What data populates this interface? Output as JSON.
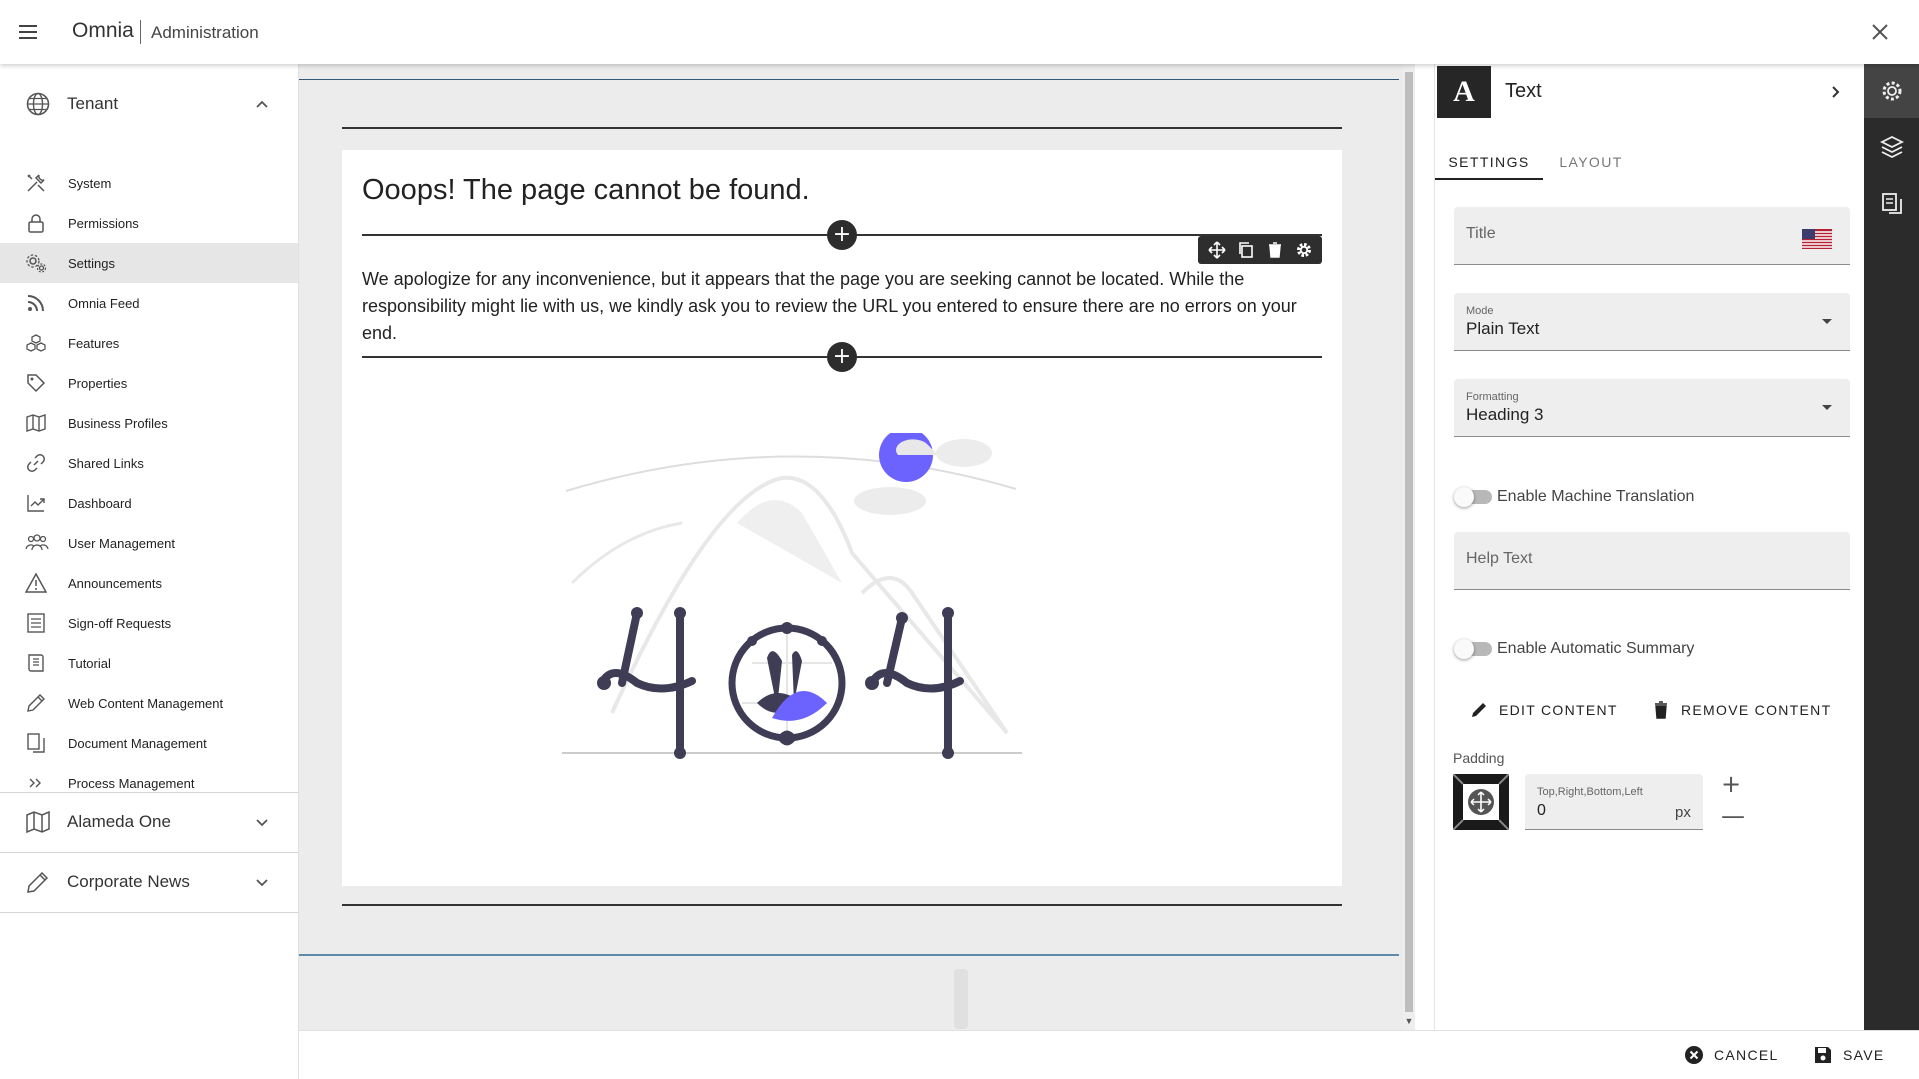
{
  "header": {
    "app_name": "Omnia",
    "section": "Administration"
  },
  "sidebar": {
    "groups": [
      {
        "label": "Tenant",
        "icon": "globe-icon",
        "expanded": true
      },
      {
        "label": "Alameda One",
        "icon": "map-icon",
        "expanded": false
      },
      {
        "label": "Corporate News",
        "icon": "pen-icon",
        "expanded": false
      }
    ],
    "items": [
      {
        "label": "System",
        "icon": "tools-icon"
      },
      {
        "label": "Permissions",
        "icon": "lock-icon"
      },
      {
        "label": "Settings",
        "icon": "settings-gears-icon",
        "active": true
      },
      {
        "label": "Omnia Feed",
        "icon": "rss-icon"
      },
      {
        "label": "Features",
        "icon": "cubes-icon"
      },
      {
        "label": "Properties",
        "icon": "tag-icon"
      },
      {
        "label": "Business Profiles",
        "icon": "map-icon"
      },
      {
        "label": "Shared Links",
        "icon": "link-icon"
      },
      {
        "label": "Dashboard",
        "icon": "chart-icon"
      },
      {
        "label": "User Management",
        "icon": "users-icon"
      },
      {
        "label": "Announcements",
        "icon": "warning-icon"
      },
      {
        "label": "Sign-off Requests",
        "icon": "list-icon"
      },
      {
        "label": "Tutorial",
        "icon": "book-icon"
      },
      {
        "label": "Web Content Management",
        "icon": "pencil-icon"
      },
      {
        "label": "Document Management",
        "icon": "documents-icon"
      },
      {
        "label": "Process Management",
        "icon": "chevrons-right-icon"
      }
    ]
  },
  "content": {
    "heading": "Ooops! The page cannot be found.",
    "body": "We apologize for any inconvenience, but it appears that the page you are seeking cannot be located. While the responsibility might lie with us, we kindly ask you to review the URL you entered to ensure there are no errors on your end.",
    "add_symbol": "+",
    "illustration": "404 illustration",
    "accent_color": "#6c63ff",
    "ink_color": "#3f3d56"
  },
  "panel": {
    "type_badge": "A",
    "type_title": "Text",
    "tabs": [
      "SETTINGS",
      "LAYOUT"
    ],
    "fields": {
      "title_placeholder": "Title",
      "mode_label": "Mode",
      "mode_value": "Plain Text",
      "formatting_label": "Formatting",
      "formatting_value": "Heading 3",
      "help_text_placeholder": "Help Text"
    },
    "toggles": {
      "machine_translation": "Enable Machine Translation",
      "automatic_summary": "Enable Automatic Summary"
    },
    "actions": {
      "edit": "EDIT CONTENT",
      "remove": "REMOVE CONTENT"
    },
    "padding": {
      "label": "Padding",
      "float_label": "Top,Right,Bottom,Left",
      "value": "0",
      "unit": "px",
      "plus": "+",
      "minus": "—"
    }
  },
  "footer": {
    "cancel": "CANCEL",
    "save": "SAVE"
  }
}
